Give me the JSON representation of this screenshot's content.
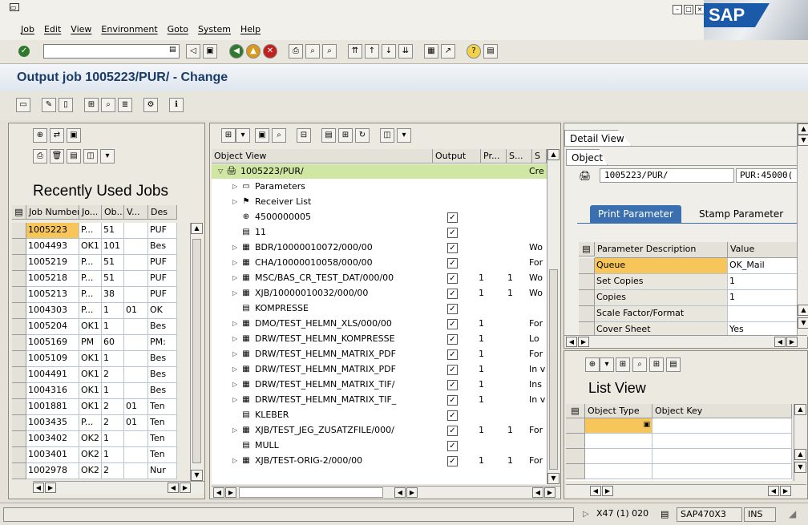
{
  "menu": [
    "Job",
    "Edit",
    "View",
    "Environment",
    "Goto",
    "System",
    "Help"
  ],
  "brand": "SAP",
  "title": "Output job 1005223/PUR/ - Change",
  "recent_jobs": {
    "title": "Recently Used Jobs",
    "columns": [
      "Job Number",
      "Jo...",
      "Ob...",
      "V...",
      "Des"
    ],
    "rows": [
      [
        "1005223",
        "P...",
        "51",
        "",
        "PUF"
      ],
      [
        "1004493",
        "OK1",
        "101",
        "",
        "Bes"
      ],
      [
        "1005219",
        "P...",
        "51",
        "",
        "PUF"
      ],
      [
        "1005218",
        "P...",
        "51",
        "",
        "PUF"
      ],
      [
        "1005213",
        "P...",
        "38",
        "",
        "PUF"
      ],
      [
        "1004303",
        "P...",
        "1",
        "01",
        "OK"
      ],
      [
        "1005204",
        "OK1",
        "1",
        "",
        "Bes"
      ],
      [
        "1005169",
        "PM",
        "60",
        "",
        "PM:"
      ],
      [
        "1005109",
        "OK1",
        "1",
        "",
        "Bes"
      ],
      [
        "1004491",
        "OK1",
        "2",
        "",
        "Bes"
      ],
      [
        "1004316",
        "OK1",
        "1",
        "",
        "Bes"
      ],
      [
        "1001881",
        "OK1",
        "2",
        "01",
        "Ten"
      ],
      [
        "1003435",
        "P...",
        "2",
        "01",
        "Ten"
      ],
      [
        "1003402",
        "OK2",
        "1",
        "",
        "Ten"
      ],
      [
        "1003401",
        "OK2",
        "1",
        "",
        "Ten"
      ],
      [
        "1002978",
        "OK2",
        "2",
        "",
        "Nur"
      ]
    ]
  },
  "object_view": {
    "columns": [
      "Object View",
      "Output",
      "Pr...",
      "S...",
      "S"
    ],
    "rows": [
      {
        "label": "1005223/PUR/",
        "indent": 0,
        "exp": "open",
        "icon": "job",
        "out": false,
        "pr": "",
        "s1": "",
        "s2": "Cre"
      },
      {
        "label": "Parameters",
        "indent": 1,
        "exp": "closed",
        "icon": "params",
        "out": false,
        "pr": "",
        "s1": "",
        "s2": ""
      },
      {
        "label": "Receiver List",
        "indent": 1,
        "exp": "closed",
        "icon": "receivers",
        "out": false,
        "pr": "",
        "s1": "",
        "s2": ""
      },
      {
        "label": "4500000005",
        "indent": 1,
        "exp": "",
        "icon": "order",
        "out": true,
        "pr": "",
        "s1": "",
        "s2": ""
      },
      {
        "label": "11",
        "indent": 1,
        "exp": "",
        "icon": "printer",
        "out": true,
        "pr": "",
        "s1": "",
        "s2": ""
      },
      {
        "label": "BDR/10000010072/000/00",
        "indent": 1,
        "exp": "closed",
        "icon": "doc",
        "out": true,
        "pr": "",
        "s1": "",
        "s2": "Wo"
      },
      {
        "label": "CHA/10000010058/000/00",
        "indent": 1,
        "exp": "closed",
        "icon": "doc",
        "out": true,
        "pr": "",
        "s1": "",
        "s2": "For"
      },
      {
        "label": "MSC/BAS_CR_TEST_DAT/000/00",
        "indent": 1,
        "exp": "closed",
        "icon": "doc",
        "out": true,
        "pr": "1",
        "s1": "1",
        "s2": "Wo"
      },
      {
        "label": "XJB/10000010032/000/00",
        "indent": 1,
        "exp": "closed",
        "icon": "doc",
        "out": true,
        "pr": "1",
        "s1": "1",
        "s2": "Wo"
      },
      {
        "label": "KOMPRESSE",
        "indent": 1,
        "exp": "",
        "icon": "printer",
        "out": true,
        "pr": "",
        "s1": "",
        "s2": ""
      },
      {
        "label": "DMO/TEST_HELMN_XLS/000/00",
        "indent": 1,
        "exp": "closed",
        "icon": "doc",
        "out": true,
        "pr": "1",
        "s1": "",
        "s2": "For"
      },
      {
        "label": "DRW/TEST_HELMN_KOMPRESSE",
        "indent": 1,
        "exp": "closed",
        "icon": "doc",
        "out": true,
        "pr": "1",
        "s1": "",
        "s2": "Lo"
      },
      {
        "label": "DRW/TEST_HELMN_MATRIX_PDF",
        "indent": 1,
        "exp": "closed",
        "icon": "doc",
        "out": true,
        "pr": "1",
        "s1": "",
        "s2": "For"
      },
      {
        "label": "DRW/TEST_HELMN_MATRIX_PDF",
        "indent": 1,
        "exp": "closed",
        "icon": "doc",
        "out": true,
        "pr": "1",
        "s1": "",
        "s2": "In v"
      },
      {
        "label": "DRW/TEST_HELMN_MATRIX_TIF/",
        "indent": 1,
        "exp": "closed",
        "icon": "doc",
        "out": true,
        "pr": "1",
        "s1": "",
        "s2": "Ins"
      },
      {
        "label": "DRW/TEST_HELMN_MATRIX_TIF_",
        "indent": 1,
        "exp": "closed",
        "icon": "doc",
        "out": true,
        "pr": "1",
        "s1": "",
        "s2": "In v"
      },
      {
        "label": "KLEBER",
        "indent": 1,
        "exp": "",
        "icon": "printer",
        "out": true,
        "pr": "",
        "s1": "",
        "s2": ""
      },
      {
        "label": "XJB/TEST_JEG_ZUSATZFILE/000/",
        "indent": 1,
        "exp": "closed",
        "icon": "doc",
        "out": true,
        "pr": "1",
        "s1": "1",
        "s2": "For"
      },
      {
        "label": "MULL",
        "indent": 1,
        "exp": "",
        "icon": "printer",
        "out": true,
        "pr": "",
        "s1": "",
        "s2": ""
      },
      {
        "label": "XJB/TEST-ORIG-2/000/00",
        "indent": 1,
        "exp": "closed",
        "icon": "doc",
        "out": true,
        "pr": "1",
        "s1": "1",
        "s2": "For"
      }
    ]
  },
  "detail": {
    "tab_label": "Detail View",
    "object_label": "Object",
    "object_value": "1005223/PUR/",
    "object_key": "PUR:45000(",
    "tabs": [
      "Print Parameter",
      "Stamp Parameter"
    ],
    "columns": [
      "Parameter Description",
      "Value"
    ],
    "rows": [
      [
        "Queue",
        "OK_Mail"
      ],
      [
        "Set Copies",
        "1"
      ],
      [
        "Copies",
        "1"
      ],
      [
        "Scale Factor/Format",
        ""
      ],
      [
        "Cover Sheet",
        "Yes"
      ]
    ]
  },
  "list_view": {
    "title": "List View",
    "columns": [
      "Object Type",
      "Object Key"
    ]
  },
  "status": {
    "system": "X47 (1) 020",
    "server": "SAP470X3",
    "mode": "INS"
  },
  "colors": {
    "highlight": "#f7c65a",
    "tree_selected": "#cfe7a3",
    "brand_blue": "#1b5aa8",
    "title_blue": "#1a3c6a"
  }
}
